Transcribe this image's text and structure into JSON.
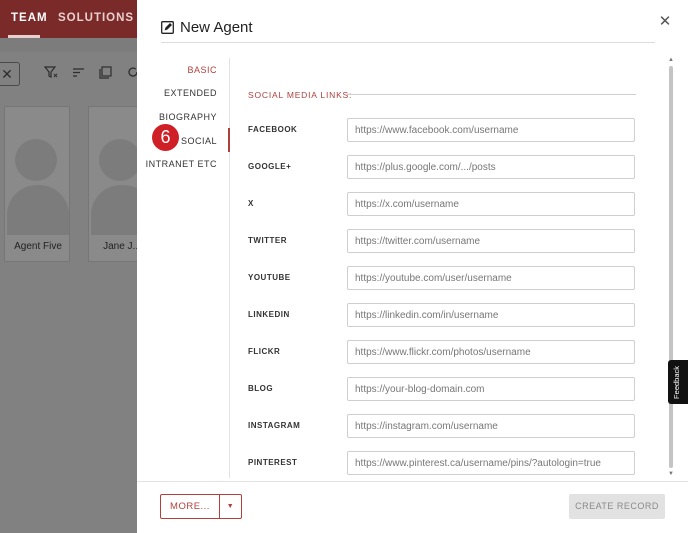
{
  "background": {
    "tabs": [
      "TEAM",
      "SOLUTIONS"
    ],
    "cards": [
      {
        "name": "Agent Five"
      },
      {
        "name": "Jane J..."
      }
    ]
  },
  "modal": {
    "title": "New Agent",
    "nav": [
      {
        "label": "BASIC",
        "active": false
      },
      {
        "label": "EXTENDED",
        "active": false
      },
      {
        "label": "BIOGRAPHY",
        "active": false
      },
      {
        "label": "SOCIAL",
        "active": true
      },
      {
        "label": "INTRANET ETC",
        "active": false
      }
    ],
    "step_badge": "6",
    "section_title": "SOCIAL MEDIA LINKS:",
    "fields": [
      {
        "label": "FACEBOOK",
        "placeholder": "https://www.facebook.com/username",
        "value": ""
      },
      {
        "label": "GOOGLE+",
        "placeholder": "https://plus.google.com/.../posts",
        "value": ""
      },
      {
        "label": "X",
        "placeholder": "https://x.com/username",
        "value": ""
      },
      {
        "label": "TWITTER",
        "placeholder": "https://twitter.com/username",
        "value": ""
      },
      {
        "label": "YOUTUBE",
        "placeholder": "https://youtube.com/user/username",
        "value": ""
      },
      {
        "label": "LINKEDIN",
        "placeholder": "https://linkedin.com/in/username",
        "value": ""
      },
      {
        "label": "FLICKR",
        "placeholder": "https://www.flickr.com/photos/username",
        "value": ""
      },
      {
        "label": "BLOG",
        "placeholder": "https://your-blog-domain.com",
        "value": ""
      },
      {
        "label": "INSTAGRAM",
        "placeholder": "https://instagram.com/username",
        "value": ""
      },
      {
        "label": "PINTEREST",
        "placeholder": "https://www.pinterest.ca/username/pins/?autologin=true",
        "value": ""
      }
    ],
    "footer": {
      "more_label": "MORE...",
      "create_label": "CREATE RECORD"
    }
  },
  "feedback_label": "Feedback",
  "colors": {
    "accent": "#b0403c",
    "step_badge": "#cf2027",
    "topbar": "#7a2a28"
  }
}
